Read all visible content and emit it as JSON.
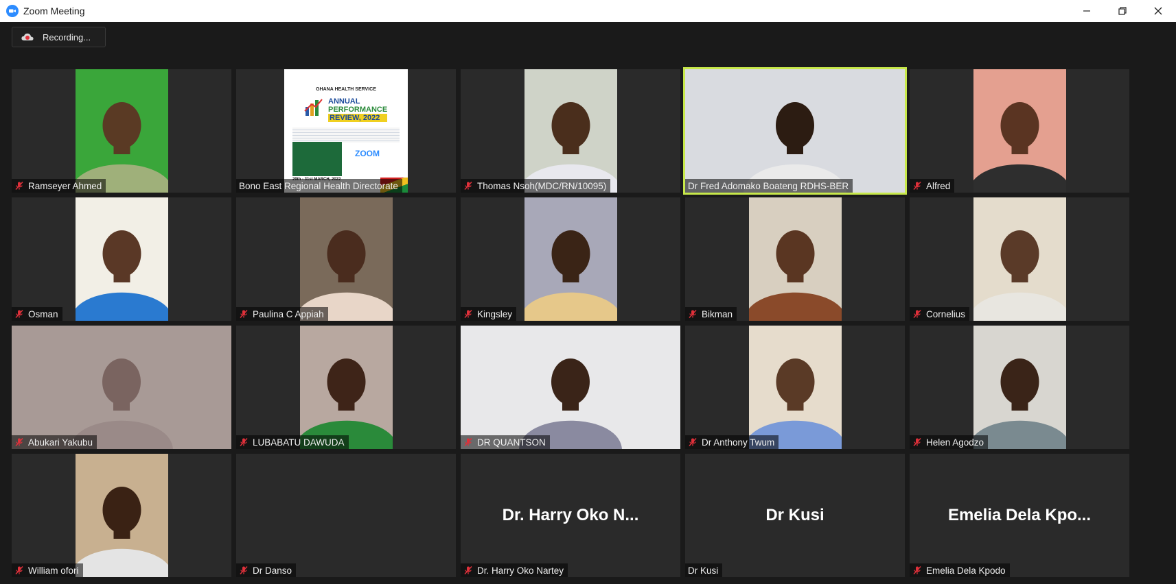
{
  "window": {
    "title": "Zoom Meeting"
  },
  "recording": {
    "label": "Recording..."
  },
  "participants": [
    {
      "name": "Ramseyer Ahmed",
      "muted": true,
      "bg": "#3aa63a",
      "skin": "#5a3a24",
      "shirt": "#9fb07a"
    },
    {
      "name": "Bono East Regional Health Directorate",
      "muted": false,
      "poster": true
    },
    {
      "name": "Thomas Nsoh(MDC/RN/10095)",
      "muted": true,
      "bg": "#cfd3c8",
      "skin": "#4a2e1c",
      "shirt": "#e8e8ee"
    },
    {
      "name": "Dr Fred Adomako Boateng RDHS-BER",
      "muted": false,
      "active": true,
      "bg": "#d9dbe0",
      "skin": "#2c1c12",
      "shirt": "#eaeaea"
    },
    {
      "name": "Alfred",
      "muted": true,
      "bg": "#e4a090",
      "skin": "#5a3422",
      "shirt": "#2e2e2e"
    },
    {
      "name": "Osman",
      "muted": true,
      "bg": "#f2efe6",
      "skin": "#5a3826",
      "shirt": "#2a7ad0"
    },
    {
      "name": "Paulina C Appiah",
      "muted": true,
      "bg": "#7a6a5a",
      "skin": "#4a2c1e",
      "shirt": "#e8d6c8"
    },
    {
      "name": "Kingsley",
      "muted": true,
      "bg": "#a8a8b8",
      "skin": "#3a2416",
      "shirt": "#e6c88a"
    },
    {
      "name": "Bikman",
      "muted": true,
      "bg": "#d8cfc0",
      "skin": "#5a3622",
      "shirt": "#8a4a2a"
    },
    {
      "name": "Cornelius",
      "muted": true,
      "bg": "#e4dccc",
      "skin": "#5a3a28",
      "shirt": "#e8e6e0"
    },
    {
      "name": "Abukari Yakubu",
      "muted": true,
      "bg": "#a89a96",
      "skin": "#7a6460",
      "shirt": "#9a8a88",
      "wide": true
    },
    {
      "name": "LUBABATU DAWUDA",
      "muted": true,
      "bg": "#b8a8a0",
      "skin": "#3e2418",
      "shirt": "#2a8a3a"
    },
    {
      "name": "DR QUANTSON",
      "muted": true,
      "bg": "#e8e8ea",
      "skin": "#3a2418",
      "shirt": "#8a8aa0",
      "wide": true
    },
    {
      "name": "Dr Anthony Twum",
      "muted": true,
      "bg": "#e6dccc",
      "skin": "#5a3a26",
      "shirt": "#7a9ad8"
    },
    {
      "name": "Helen Agodzo",
      "muted": true,
      "bg": "#d8d6d0",
      "skin": "#3a2418",
      "shirt": "#7a8a90"
    },
    {
      "name": "William ofori",
      "muted": true,
      "bg": "#c8b090",
      "skin": "#3a2214",
      "shirt": "#e4e4e4"
    },
    {
      "name": "Dr Danso",
      "muted": true,
      "noVideo": true,
      "display": ""
    },
    {
      "name": "Dr. Harry Oko Nartey",
      "muted": true,
      "noVideo": true,
      "display": "Dr. Harry Oko N..."
    },
    {
      "name": "Dr Kusi",
      "muted": false,
      "noVideo": true,
      "display": "Dr Kusi"
    },
    {
      "name": "Emelia Dela Kpodo",
      "muted": true,
      "noVideo": true,
      "display": "Emelia Dela Kpo..."
    }
  ],
  "poster": {
    "org": "GHANA HEALTH SERVICE",
    "headline1": "ANNUAL",
    "headline2": "PERFORMANCE",
    "headline3": "REVIEW, 2022",
    "dates": "29th - 31st MARCH, 2022",
    "platform": "ZOOM"
  },
  "colors": {
    "accent": "#c7e84a",
    "mute": "#e0303a",
    "brand": "#2d8cff"
  }
}
